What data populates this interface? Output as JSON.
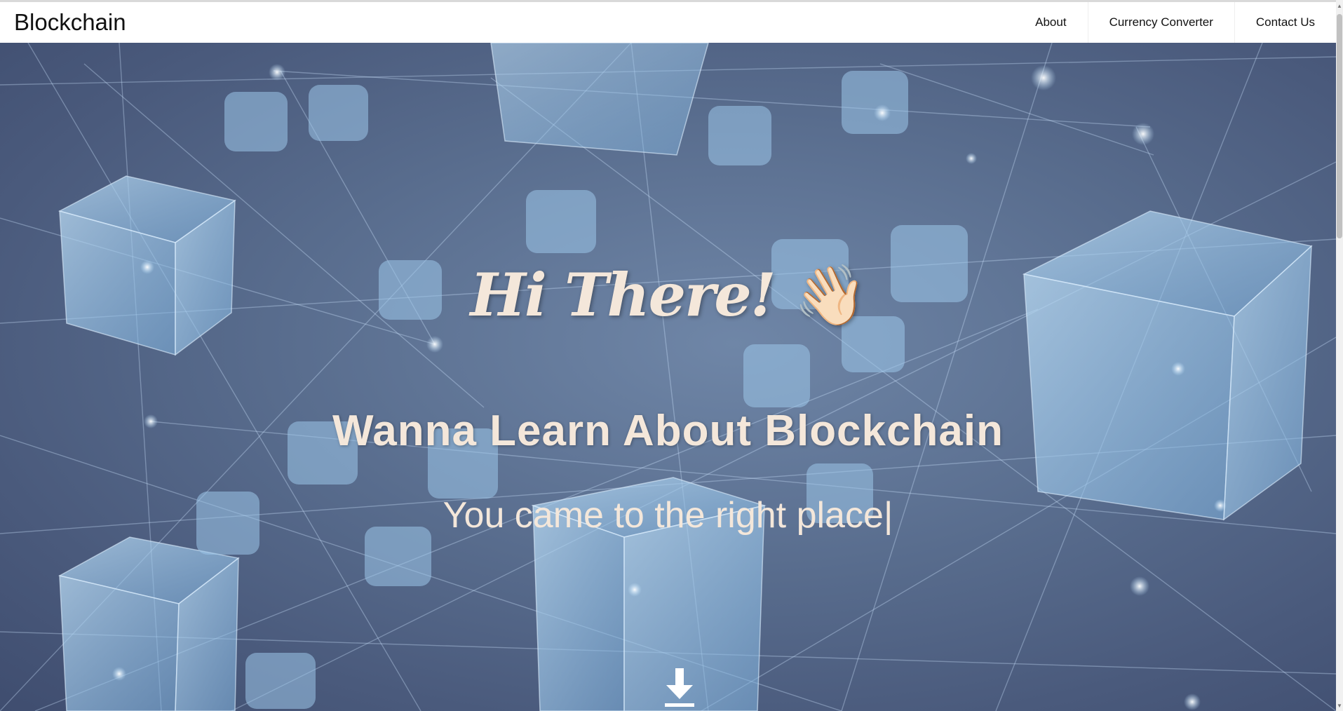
{
  "navbar": {
    "brand": "Blockchain",
    "links": [
      {
        "label": "About"
      },
      {
        "label": "Currency Converter"
      },
      {
        "label": "Contact Us"
      }
    ]
  },
  "hero": {
    "greeting": "Hi There!",
    "wave_emoji": "👋🏻",
    "headline": "Wanna Learn About Blockchain",
    "typed_text": "You came to the right place",
    "typing_cursor": "|",
    "scroll_icon": "arrow-down-icon",
    "text_color": "#f4e7da",
    "background_color": "#586c8d"
  }
}
